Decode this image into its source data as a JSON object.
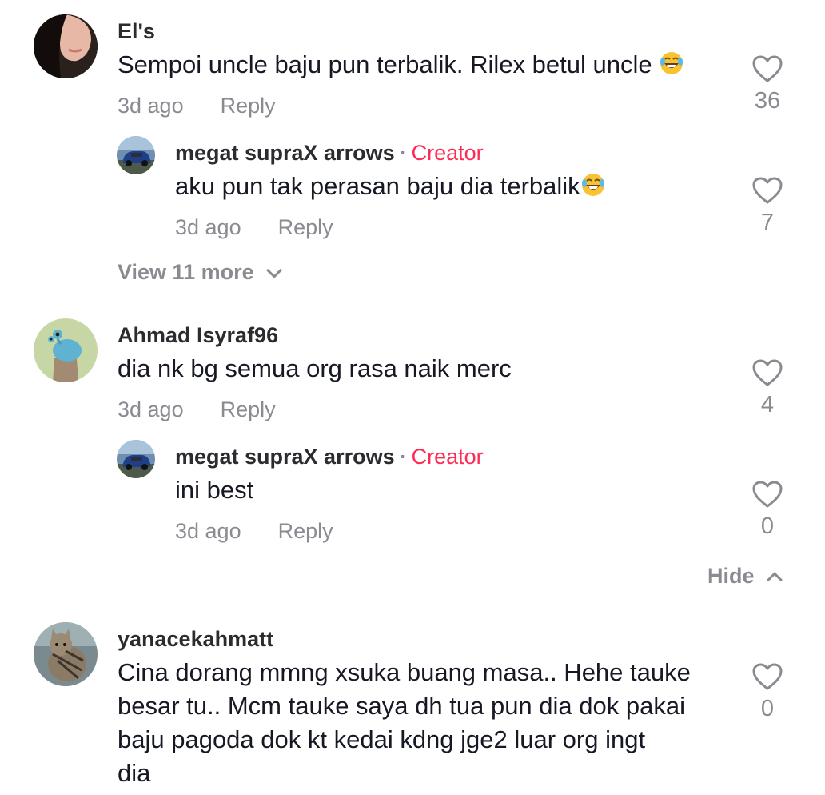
{
  "comments": [
    {
      "username": "El's",
      "text": "Sempoi uncle baju pun terbalik. Rilex betul uncle",
      "emoji": "laughing-tears-emoji",
      "time": "3d ago",
      "reply_label": "Reply",
      "likes": "36",
      "replies": [
        {
          "username": "megat supraX arrows",
          "separator": "·",
          "badge": "Creator",
          "text": "aku pun tak perasan baju dia terbalik",
          "emoji": "laughing-tears-emoji",
          "time": "3d ago",
          "reply_label": "Reply",
          "likes": "7"
        }
      ],
      "view_more": "View 11 more"
    },
    {
      "username": "Ahmad Isyraf96",
      "text": "dia nk bg semua org rasa naik merc",
      "time": "3d ago",
      "reply_label": "Reply",
      "likes": "4",
      "replies": [
        {
          "username": "megat supraX arrows",
          "separator": "·",
          "badge": "Creator",
          "text": "ini best",
          "time": "3d ago",
          "reply_label": "Reply",
          "likes": "0"
        }
      ],
      "hide_label": "Hide"
    },
    {
      "username": "yanacekahmatt",
      "text_lines": [
        "Cina dorang mmng xsuka buang masa.. Hehe tauke",
        "besar tu.. Mcm tauke saya dh tua pun dia dok pakai",
        "baju pagoda dok kt kedai kdng jge2 luar org ingt",
        "dia"
      ],
      "likes": "0"
    }
  ],
  "colors": {
    "text": "#161823",
    "secondary": "#8a8b91",
    "creator": "#fe2c55"
  },
  "icons": {
    "like": "heart-outline-icon",
    "expand": "chevron-down-icon",
    "collapse": "chevron-up-icon"
  }
}
